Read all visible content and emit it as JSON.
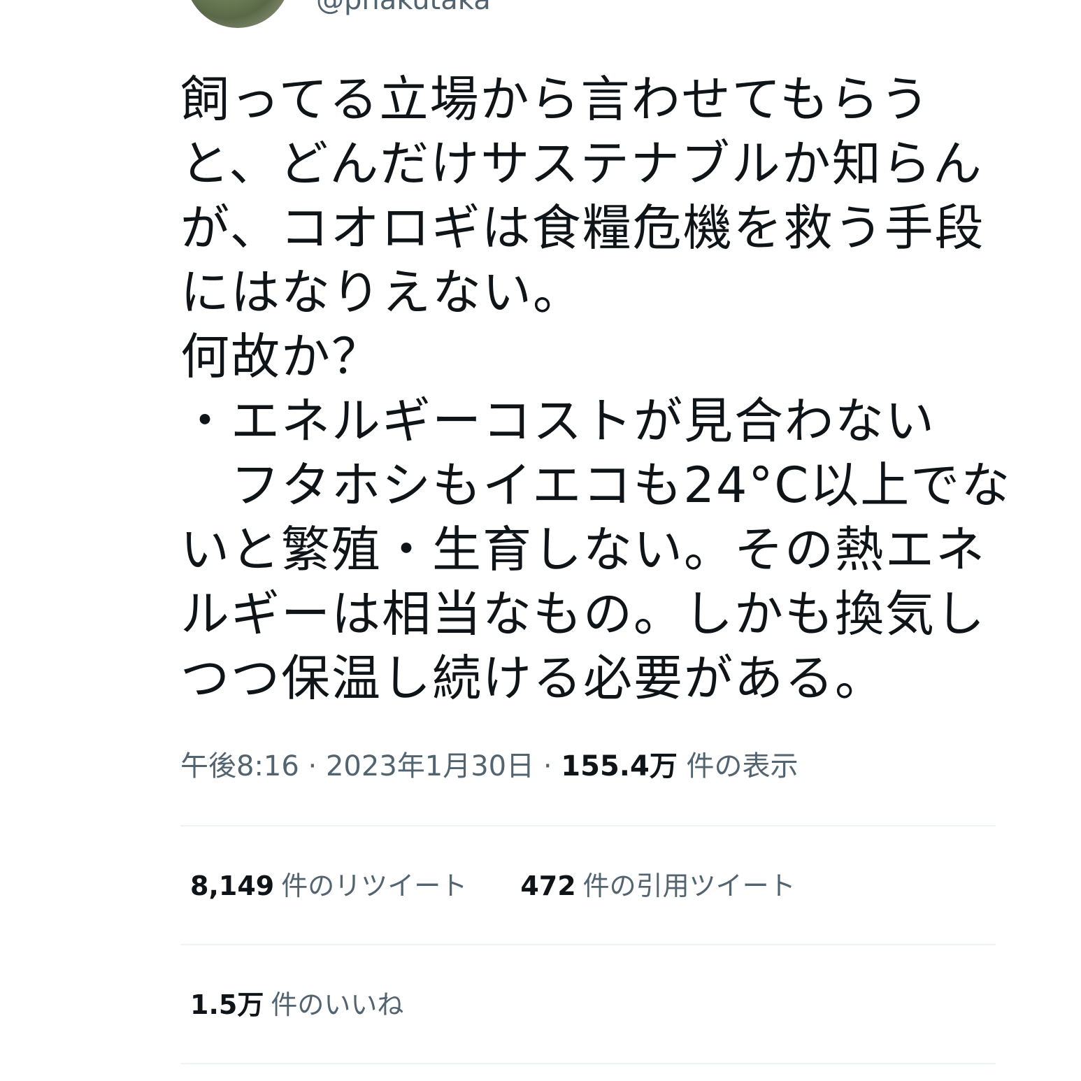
{
  "user": {
    "handle": "@phakutaka"
  },
  "tweet": {
    "lines": [
      "飼ってる立場から言わせてもらう",
      "と、どんだけサステナブルか知らん",
      "が、コオロギは食糧危機を救う手段",
      "にはなりえない。",
      "何故か？",
      "・エネルギーコストが見合わない",
      "　フタホシもイエコも24°C以上でな",
      "いと繁殖・生育しない。その熱エネ",
      "ルギーは相当なもの。しかも換気し",
      "つつ保温し続ける必要がある。"
    ]
  },
  "meta": {
    "time": "午後8:16",
    "separator": "·",
    "date": "2023年1月30日",
    "views_count": "155.4万",
    "views_label": "件の表示"
  },
  "stats": {
    "retweets_count": "8,149",
    "retweets_label": "件のリツイート",
    "quotes_count": "472",
    "quotes_label": "件の引用ツイート",
    "likes_count": "1.5万",
    "likes_label": "件のいいね"
  }
}
